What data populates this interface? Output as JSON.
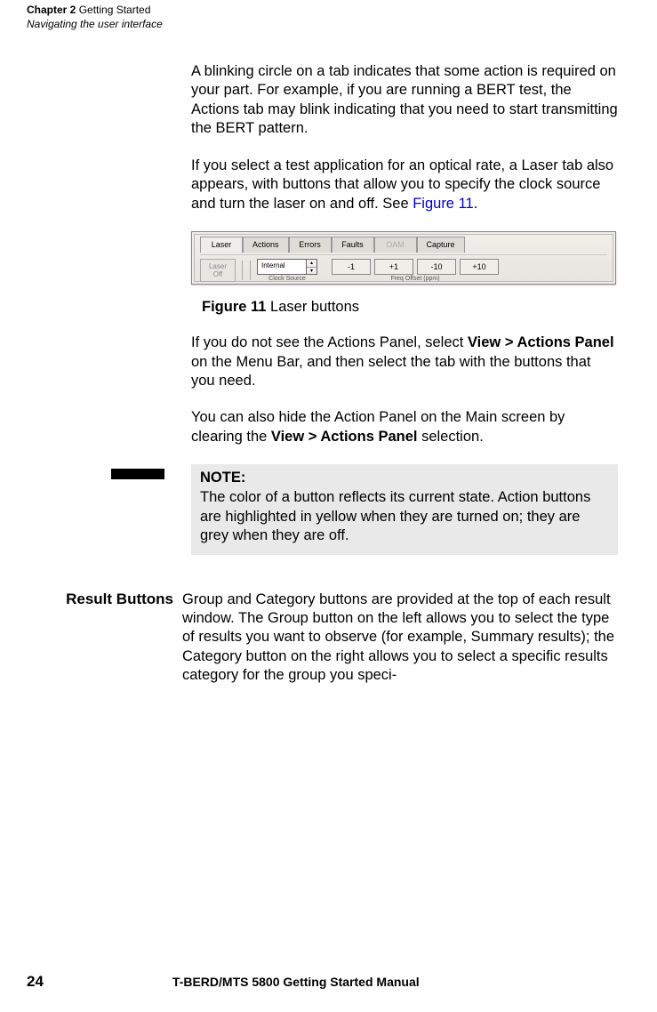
{
  "header": {
    "chapter_bold": "Chapter 2",
    "chapter_rest": "  Getting Started",
    "subtitle": "Navigating the user interface"
  },
  "para1": "A blinking circle on a tab indicates that some action is required on your part. For example, if you are running a BERT test, the Actions tab may blink indicating that you need to start transmitting the BERT pattern.",
  "para2_a": "If you select a test application for an optical rate, a Laser  tab also appears, with buttons that allow you to specify the clock source and turn the laser on and off. See ",
  "para2_link": "Figure 11",
  "para2_b": ".",
  "figure": {
    "tabs": [
      "Laser",
      "Actions",
      "Errors",
      "Faults",
      "OAM",
      "Capture"
    ],
    "laser_off_line1": "Laser",
    "laser_off_line2": "Off",
    "clock_value": "Internal",
    "clock_label": "Clock Source",
    "freq_buttons": [
      "-1",
      "+1",
      "-10",
      "+10"
    ],
    "freq_label": "Freq Offset (ppm)",
    "caption_num": "Figure 11",
    "caption_text": "  Laser buttons"
  },
  "para3_a": "If you do not see the Actions Panel, select ",
  "para3_bold": "View > Actions Panel",
  "para3_b": " on the Menu Bar, and then select the tab with the buttons that you need.",
  "para4_a": "You can also hide the Action Panel on the Main screen by clearing the ",
  "para4_bold": "View > Actions Panel",
  "para4_b": " selection.",
  "note": {
    "title": "NOTE:",
    "text": "The color of a button reflects its current state. Action buttons are highlighted in yellow when they are turned on; they are grey when they are off."
  },
  "section": {
    "heading": "Result Buttons",
    "text": "Group and Category buttons are provided at the top of each result window. The Group button on the left allows you to select the type of results you want to observe (for example, Summary results); the Category button on the right allows you to select a specific results category for the group you speci-"
  },
  "footer": {
    "page": "24",
    "title": "T-BERD/MTS 5800 Getting Started Manual"
  }
}
